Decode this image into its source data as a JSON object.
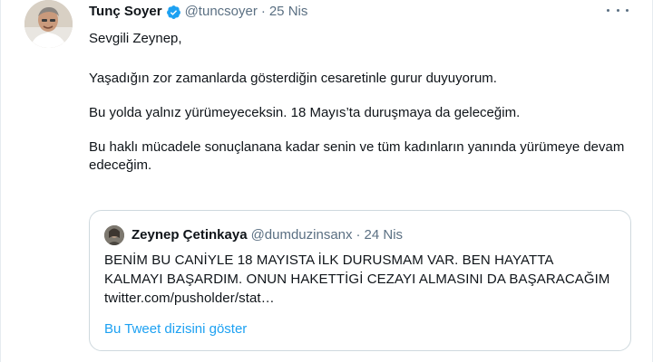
{
  "author": {
    "name": "Tunç Soyer",
    "handle": "@tuncsoyer",
    "separator": "·",
    "date": "25 Nis",
    "verified": true,
    "avatar_icon": "user-avatar-photo",
    "verified_icon": "verified-badge-icon"
  },
  "tweet": {
    "paragraphs": [
      "Sevgili Zeynep,",
      "Yaşadığın zor zamanlarda gösterdiğin cesaretinle gurur duyuyorum.",
      "Bu yolda yalnız yürümeyeceksin. 18 Mayıs’ta duruşmaya da geleceğim.",
      "Bu haklı mücadele sonuçlanana kadar senin ve tüm kadınların yanında yürümeye devam edeceğim."
    ]
  },
  "quoted": {
    "name": "Zeynep Çetinkaya",
    "handle": "@dumduzinsanx",
    "separator": "·",
    "date": "24 Nis",
    "text": "BENİM BU CANİYLE 18 MAYISTA İLK DURUSMAM VAR. BEN HAYATTA KALMAYI BAŞARDIM. ONUN HAKETTİGİ CEZAYI ALMASINI DA BAŞARACAĞIM twitter.com/pusholder/stat…",
    "show_thread": "Bu Tweet dizisini göster"
  },
  "colors": {
    "accent": "#1da1f2",
    "muted": "#5b7083",
    "text": "#0f1419",
    "border": "#cfd9de"
  }
}
